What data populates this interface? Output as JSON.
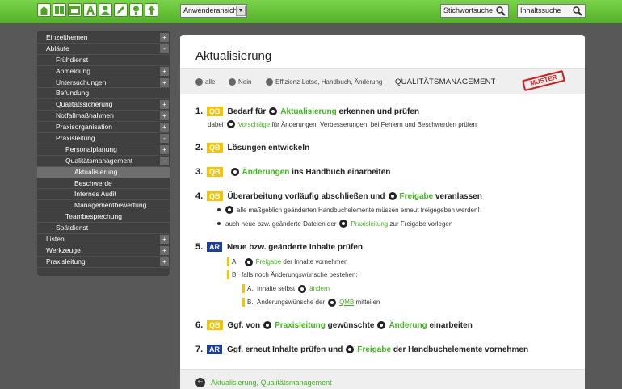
{
  "toolbar": {
    "icons": [
      "home-icon",
      "book-icon",
      "window-icon",
      "text-a-icon",
      "user-icon",
      "pencil-icon",
      "bulb-icon",
      "upload-icon"
    ],
    "view_select": "Anwenderansicht",
    "search_keyword_placeholder": "Stichwortsuche",
    "search_content_placeholder": "Inhaltssuche"
  },
  "sidebar": {
    "items": [
      {
        "label": "Einzelthemen",
        "toggle": "+"
      },
      {
        "label": "Abläufe",
        "toggle": "-"
      },
      {
        "label": "Frühdienst",
        "toggle": ""
      },
      {
        "label": "Anmeldung",
        "toggle": "+"
      },
      {
        "label": "Untersuchungen",
        "toggle": "+"
      },
      {
        "label": "Befundung",
        "toggle": ""
      },
      {
        "label": "Qualitätssicherung",
        "toggle": "+"
      },
      {
        "label": "Notfallmaßnahmen",
        "toggle": "+"
      },
      {
        "label": "Praxisorganisation",
        "toggle": "+"
      },
      {
        "label": "Praxisleitung",
        "toggle": "-"
      },
      {
        "label": "Personalplanung",
        "toggle": "+"
      },
      {
        "label": "Qualitätsmanagement",
        "toggle": "-"
      },
      {
        "label": "Aktualisierung",
        "toggle": ""
      },
      {
        "label": "Beschwerde",
        "toggle": ""
      },
      {
        "label": "Internes Audit",
        "toggle": ""
      },
      {
        "label": "Managementbewertung",
        "toggle": ""
      },
      {
        "label": "Teambesprechung",
        "toggle": ""
      },
      {
        "label": "Spätdienst",
        "toggle": ""
      },
      {
        "label": "Listen",
        "toggle": "+"
      },
      {
        "label": "Werkzeuge",
        "toggle": "+"
      },
      {
        "label": "Praxisleitung",
        "toggle": "+"
      }
    ]
  },
  "main": {
    "title": "Aktualisierung",
    "filters": {
      "all": "alle",
      "no": "Nein",
      "tags": "Effizienz-Lotse, Handbuch, Änderung",
      "qm": "QUALITÄTSMANAGEMENT",
      "stamp": "MUSTER"
    },
    "steps": {
      "s1": {
        "num": "1.",
        "badge": "QB",
        "pre": "Bedarf für",
        "link": "Aktualisierung",
        "post": "erkennen und prüfen",
        "sub_pre": "dabei",
        "sub_link": "Vorschläge",
        "sub_post": "für Änderungen, Verbesserungen, bei Fehlern und Beschwerden prüfen"
      },
      "s2": {
        "num": "2.",
        "badge": "QB",
        "text": "Lösungen entwickeln"
      },
      "s3": {
        "num": "3.",
        "badge": "QB",
        "link": "Änderungen",
        "post": "ins Handbuch einarbeiten"
      },
      "s4": {
        "num": "4.",
        "badge": "QB",
        "pre": "Überarbeitung vorläufig abschließen und",
        "link": "Freigabe",
        "post": "veranlassen",
        "b1": "alle maßgeblich geänderten Handbuchelemente müssen erneut freigegeben werden!",
        "b2_pre": "auch neue bzw. geänderte Dateien der",
        "b2_link": "Praxisleitung",
        "b2_post": "zur Freigabe vorlegen"
      },
      "s5": {
        "num": "5.",
        "badge": "AR",
        "text": "Neue bzw. geänderte Inhalte prüfen",
        "a_label": "A.",
        "a_link": "Freigabe",
        "a_post": "der Inhalte vornehmen",
        "b_label": "B.",
        "b_text": "falls noch Änderungswünsche bestehen:",
        "ba_label": "A.",
        "ba_pre": "Inhalte selbst",
        "ba_link": "ändern",
        "bb_label": "B.",
        "bb_pre": "Änderungswünsche der",
        "bb_link": "QMB",
        "bb_post": "mitteilen"
      },
      "s6": {
        "num": "6.",
        "badge": "QB",
        "pre": "Ggf. von",
        "link1": "Praxisleitung",
        "mid": "gewünschte",
        "link2": "Änderung",
        "post": "einarbeiten"
      },
      "s7": {
        "num": "7.",
        "badge": "AR",
        "pre": "Ggf. erneut Inhalte prüfen und",
        "link": "Freigabe",
        "post": "der Handbuchelemente vornehmen"
      }
    },
    "footer_link": "Aktualisierung, Qualitätsmanagement"
  },
  "colors": {
    "brand_green": "#55b22a",
    "link_green": "#3db51a",
    "qb_badge": "#f7c200",
    "ar_badge": "#1d3f9c",
    "stamp_red": "#d21e1e"
  }
}
